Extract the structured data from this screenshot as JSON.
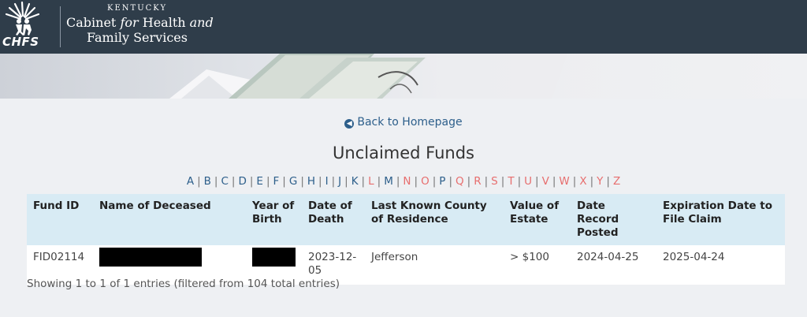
{
  "header": {
    "logo_state": "KENTUCKY",
    "logo_line1_a": "Cabinet",
    "logo_line1_b": "for",
    "logo_line1_c": "Health",
    "logo_line1_d": "and",
    "logo_line2": "Family Services",
    "logo_abbrev": "CHFS",
    "bg_color": "#2f3d4a"
  },
  "nav": {
    "back_label": "Back to Homepage"
  },
  "page_title": "Unclaimed Funds",
  "alphabet": [
    {
      "letter": "A",
      "active": true
    },
    {
      "letter": "B",
      "active": true
    },
    {
      "letter": "C",
      "active": true
    },
    {
      "letter": "D",
      "active": true
    },
    {
      "letter": "E",
      "active": true
    },
    {
      "letter": "F",
      "active": true
    },
    {
      "letter": "G",
      "active": true
    },
    {
      "letter": "H",
      "active": true
    },
    {
      "letter": "I",
      "active": true
    },
    {
      "letter": "J",
      "active": true
    },
    {
      "letter": "K",
      "active": true
    },
    {
      "letter": "L",
      "active": false
    },
    {
      "letter": "M",
      "active": true
    },
    {
      "letter": "N",
      "active": false
    },
    {
      "letter": "O",
      "active": false
    },
    {
      "letter": "P",
      "active": true
    },
    {
      "letter": "Q",
      "active": false
    },
    {
      "letter": "R",
      "active": false
    },
    {
      "letter": "S",
      "active": false
    },
    {
      "letter": "T",
      "active": false
    },
    {
      "letter": "U",
      "active": false
    },
    {
      "letter": "V",
      "active": false
    },
    {
      "letter": "W",
      "active": false
    },
    {
      "letter": "X",
      "active": false
    },
    {
      "letter": "Y",
      "active": false
    },
    {
      "letter": "Z",
      "active": false
    }
  ],
  "table": {
    "columns": [
      "Fund ID",
      "Name of Deceased",
      "Year of Birth",
      "Date of Death",
      "Last Known County of Residence",
      "Value of Estate",
      "Date Record Posted",
      "Expiration Date to File Claim"
    ],
    "rows": [
      {
        "fund_id": "FID02114",
        "name": "",
        "year_of_birth": "",
        "date_of_death": "2023-12-05",
        "county": "Jefferson",
        "value": "> $100",
        "posted": "2024-04-25",
        "expiration": "2025-04-24"
      }
    ]
  },
  "info_text": "Showing 1 to 1 of 1 entries (filtered from 104 total entries)",
  "colors": {
    "link": "#2d5f8b",
    "inactive_letter": "#e76e6e",
    "table_header_bg": "#d8ebf4"
  }
}
